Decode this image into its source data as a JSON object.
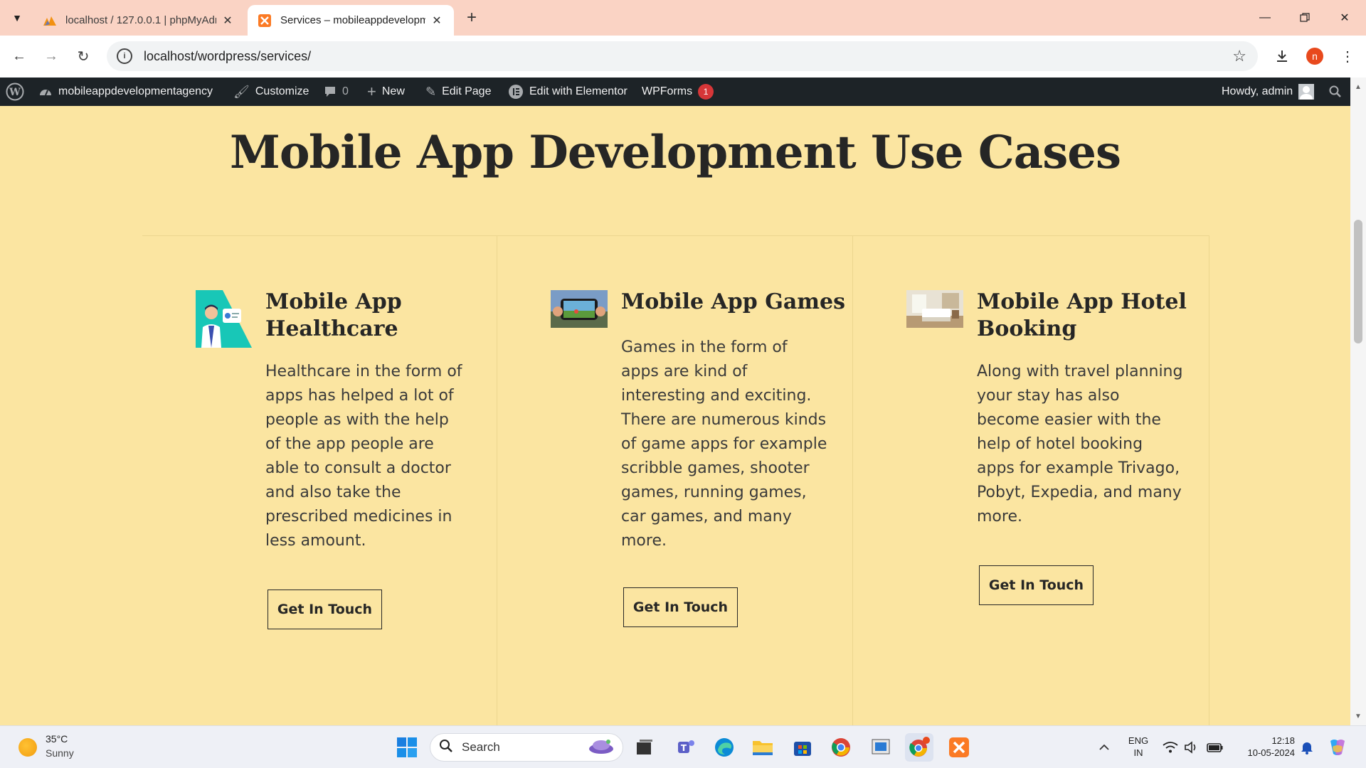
{
  "browser": {
    "tabs": [
      {
        "title": "localhost / 127.0.0.1 | phpMyAdmin",
        "icon": "phpmyadmin-icon",
        "active": false
      },
      {
        "title": "Services – mobileappdevelopmentagency",
        "icon": "xampp-icon",
        "active": true
      }
    ],
    "url": "localhost/wordpress/services/",
    "profile_initial": "n"
  },
  "adminbar": {
    "site_name": "mobileappdevelopmentagency",
    "customize": "Customize",
    "comments_count": "0",
    "new": "New",
    "edit_page": "Edit Page",
    "edit_elementor": "Edit with Elementor",
    "wpforms": "WPForms",
    "wpforms_badge": "1",
    "howdy": "Howdy, admin"
  },
  "page": {
    "title": "Mobile App Development Use Cases",
    "cards": [
      {
        "title": "Mobile App Healthcare",
        "text": "Healthcare in the form of apps has helped a lot of people as with the help of the app people are able to consult a doctor and also take the prescribed medicines in less amount.",
        "button": "Get In Touch",
        "image": "doctor-illustration"
      },
      {
        "title": "Mobile App Games",
        "text": "Games in the form of apps are kind of interesting and exciting. There are numerous kinds of game apps for example scribble games, shooter games, running games, car games, and many more.",
        "button": "Get In Touch",
        "image": "phone-game-photo"
      },
      {
        "title": "Mobile App Hotel Booking",
        "text": "Along with travel planning your stay has also become easier with the help of hotel booking apps for example Trivago, Pobyt, Expedia, and many more.",
        "button": "Get In Touch",
        "image": "hotel-room-photo"
      }
    ]
  },
  "taskbar": {
    "weather_temp": "35°C",
    "weather_desc": "Sunny",
    "search_label": "Search",
    "lang_top": "ENG",
    "lang_bottom": "IN",
    "time": "12:18",
    "date": "10-05-2024"
  },
  "colors": {
    "page_bg": "#fbe5a1",
    "adminbar_bg": "#1d2327",
    "tabstrip_bg": "#fad3c4",
    "badge_red": "#d63638"
  }
}
